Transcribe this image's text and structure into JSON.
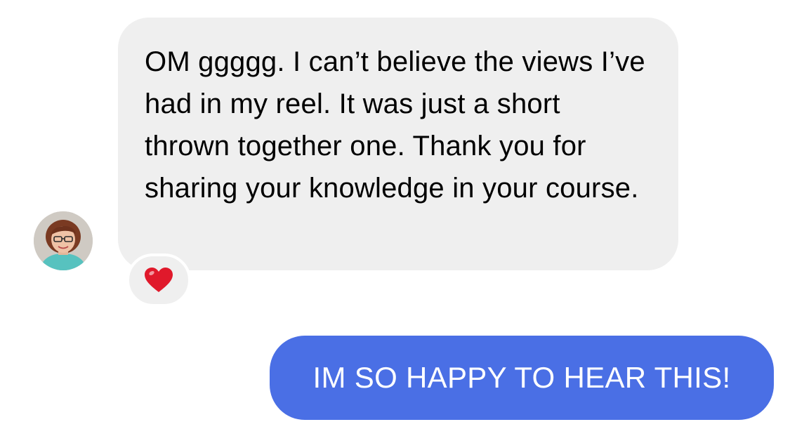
{
  "conversation": {
    "received": {
      "text": "OM ggggg. I can’t believe the views I’ve had in my reel. It was just a short thrown together one. Thank you for sharing your knowledge in your course.",
      "bubble_color": "#efefef",
      "avatar_icon": "person-avatar-icon",
      "reaction": {
        "icon": "red-heart-icon",
        "color": "#e0192b"
      }
    },
    "sent": {
      "text": "IM SO HAPPY TO HEAR THIS!",
      "bubble_color": "#4a6fe5"
    }
  }
}
